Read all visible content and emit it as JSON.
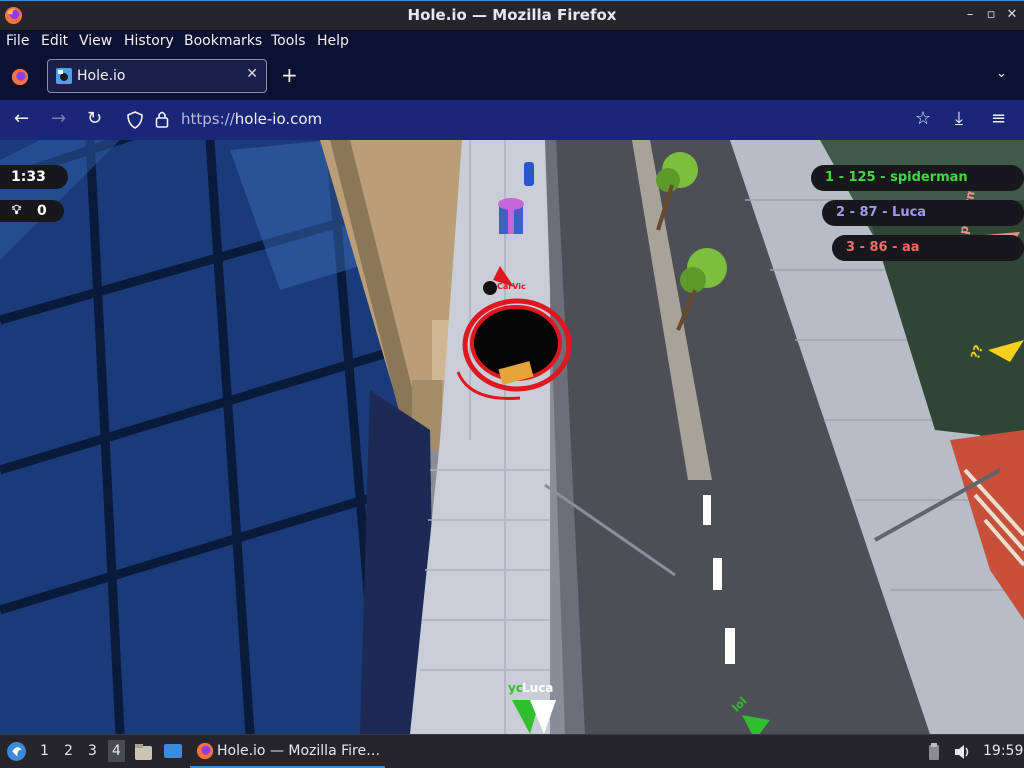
{
  "window": {
    "title": "Hole.io — Mozilla Firefox"
  },
  "menu": [
    "File",
    "Edit",
    "View",
    "History",
    "Bookmarks",
    "Tools",
    "Help"
  ],
  "tab": {
    "label": "Hole.io"
  },
  "url": {
    "protocol": "https://",
    "host": "hole-io.com"
  },
  "game": {
    "timer": "1:33",
    "score": "0",
    "leaderboard": [
      {
        "text": "1 - 125 - spiderman",
        "color": "#3ddc3d"
      },
      {
        "text": "2 - 87 - Luca",
        "color": "#9f9bf5"
      },
      {
        "text": "3 -  86 - aa",
        "color": "#f06c6c"
      }
    ],
    "player_labels": {
      "main": "CarVic",
      "bottom_a": "yc",
      "bottom_b": "Luca",
      "bottom_c": "lol",
      "right_a": "spiderman",
      "right_b": "??"
    }
  },
  "taskbar": {
    "workspaces": [
      "1",
      "2",
      "3",
      "4"
    ],
    "active_workspace": "4",
    "task_label": "Hole.io — Mozilla Fire…",
    "clock": "19:59"
  }
}
